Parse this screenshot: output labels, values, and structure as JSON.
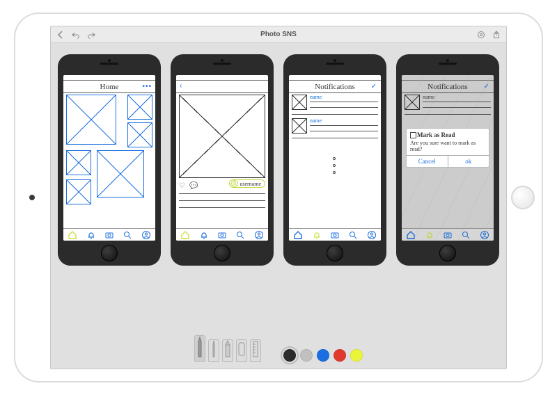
{
  "app": {
    "title": "Photo SNS"
  },
  "palette": {
    "black": "#2b2b2b",
    "grey": "#c0c0c0",
    "blue": "#1b6fe0",
    "red": "#e03a2f",
    "lime": "#eaf53a",
    "selected": "black"
  },
  "mockups": [
    {
      "id": "home",
      "header": {
        "title": "Home",
        "right_label": "•••"
      },
      "active_tab": "home"
    },
    {
      "id": "detail",
      "header": {
        "back": "‹",
        "title": ""
      },
      "username_label": "username",
      "active_tab": "home"
    },
    {
      "id": "notifications",
      "header": {
        "title": "Notifications",
        "right_label": "✓"
      },
      "items": [
        {
          "label": "name"
        },
        {
          "label": "name"
        }
      ],
      "active_tab": "notifications"
    },
    {
      "id": "notifications-dialog",
      "header": {
        "title": "Notifications",
        "right_label": "✓"
      },
      "items": [
        {
          "label": "name"
        }
      ],
      "dialog": {
        "title": "Mark as Read",
        "message": "Are you sure want to mark as read?",
        "cancel": "Cancel",
        "ok": "ok"
      },
      "active_tab": "notifications"
    }
  ],
  "tabs": [
    "home",
    "notifications",
    "camera",
    "search",
    "profile"
  ],
  "tools": [
    "pen",
    "fine-pen",
    "pencil",
    "eraser",
    "ruler"
  ]
}
